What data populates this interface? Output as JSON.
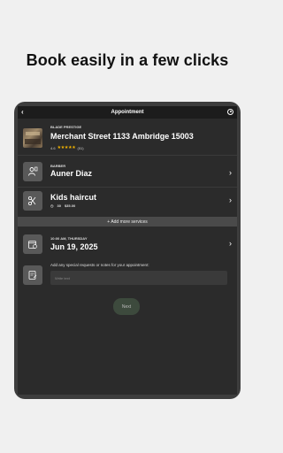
{
  "headline": "Book easily in a few clicks",
  "appbar": {
    "title": "Appointment",
    "back_icon": "back-arrow-icon",
    "account_icon": "account-icon"
  },
  "shop": {
    "name": "BLADE PRESTIGE",
    "address": "Merchant Street 1133 Ambridge 15003",
    "rating": "4.6",
    "stars": "★★★★★",
    "reviews": "(51)"
  },
  "barber": {
    "label": "BARBER",
    "name": "Auner Diaz",
    "icon": "barber-icon"
  },
  "service": {
    "name": "Kids haircut",
    "duration": "30",
    "price": "$35.00",
    "icon": "scissors-icon"
  },
  "add_services": "+ Add more services",
  "date": {
    "time_day": "10:00 AM, THURSDAY",
    "date": "Jun 19, 2025",
    "icon": "calendar-icon"
  },
  "notes": {
    "label": "Add any special requests or notes for your appointment:",
    "placeholder": "Write text",
    "icon": "note-icon"
  },
  "next_label": "Next",
  "colors": {
    "background": "#f0f0f0",
    "screen": "#2b2b2b",
    "accent_star": "#f4b400",
    "next_button": "#3d4a3d"
  }
}
